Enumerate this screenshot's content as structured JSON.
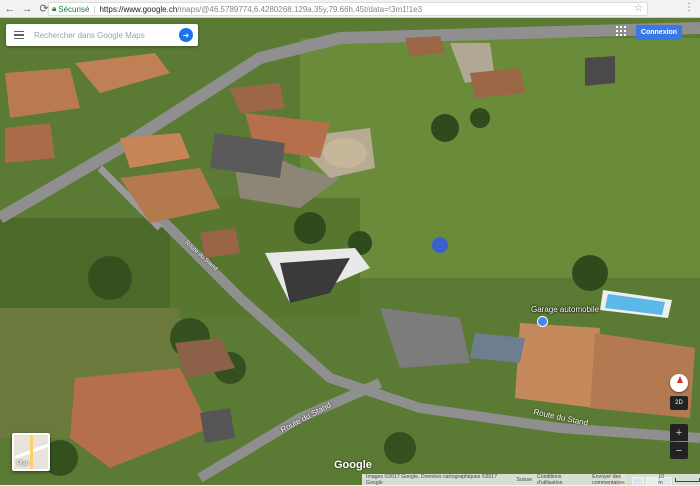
{
  "browser": {
    "secure_label": "Sécurisé",
    "url_host": "https://www.google.ch",
    "url_path": "/maps/@46.5789774,6.4280268,129a,35y,79.66h,45t/data=!3m1!1e3"
  },
  "search": {
    "placeholder": "Rechercher dans Google Maps"
  },
  "header": {
    "signin_label": "Connexion"
  },
  "map": {
    "place_label": "Garage automobile",
    "roads": [
      "Route du Stand",
      "Route du Stand",
      "Route du Stand"
    ],
    "logo": "Google",
    "layer_toggle_label": "Plan",
    "view_mode_label": "2D",
    "zoom_in": "+",
    "zoom_out": "−"
  },
  "footer": {
    "attribution": "Images ©2017 Google, Données cartographiques ©2017 Google",
    "country": "Suisse",
    "terms": "Conditions d'utilisation",
    "feedback": "Envoyer des commentaires",
    "scale": "10 m"
  },
  "colors": {
    "accent": "#3b78e7",
    "secure": "#188038"
  }
}
